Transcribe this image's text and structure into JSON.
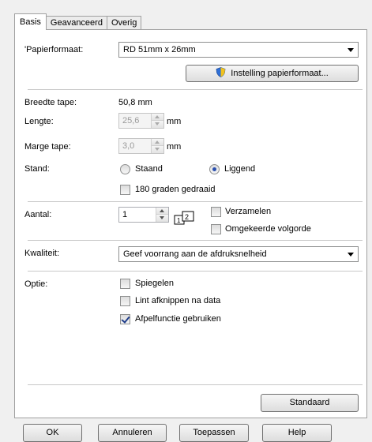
{
  "tabs": [
    "Basis",
    "Geavanceerd",
    "Overig"
  ],
  "paper": {
    "label": "'Papierformaat:",
    "value": "RD 51mm x 26mm",
    "settings_button": "Instelling papierformaat..."
  },
  "tape": {
    "width_label": "Breedte tape:",
    "width_value": "50,8 mm",
    "length_label": "Lengte:",
    "length_value": "25,6",
    "length_unit": "mm",
    "margin_label": "Marge tape:",
    "margin_value": "3,0",
    "margin_unit": "mm"
  },
  "orientation": {
    "label": "Stand:",
    "portrait": "Staand",
    "landscape": "Liggend",
    "selected": "Liggend",
    "rotate_180": "180 graden gedraaid",
    "rotate_180_checked": false
  },
  "copies": {
    "label": "Aantal:",
    "value": "1",
    "collate": "Verzamelen",
    "collate_checked": false,
    "reverse": "Omgekeerde volgorde",
    "reverse_checked": false
  },
  "quality": {
    "label": "Kwaliteit:",
    "value": "Geef voorrang aan de afdruksnelheid"
  },
  "options": {
    "label": "Optie:",
    "mirror": "Spiegelen",
    "mirror_checked": false,
    "cut_after": "Lint afknippen na data",
    "cut_after_checked": false,
    "peel": "Afpelfunctie gebruiken",
    "peel_checked": true
  },
  "default_button": "Standaard",
  "dialog_buttons": {
    "ok": "OK",
    "cancel": "Annuleren",
    "apply": "Toepassen",
    "help": "Help"
  }
}
